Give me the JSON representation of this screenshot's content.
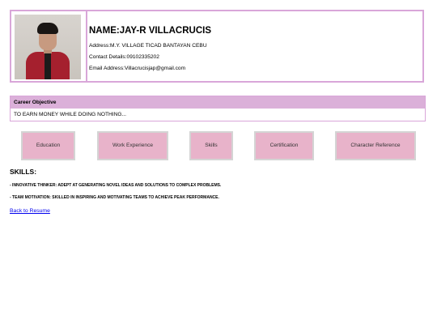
{
  "profile": {
    "name": "NAME:JAY-R VILLACRUCIS",
    "address": "Address:M.Y. VILLAGE TICAD BANTAYAN CEBU",
    "contact": "Contact Details:09102335202",
    "email": "Email Address:Villacrucisjap@gmail.com"
  },
  "career": {
    "heading": "Career Objective",
    "text": "TO EARN MONEY WHILE DOING NOTHING..."
  },
  "nav": {
    "education": "Education",
    "work_experience": "Work Experience",
    "skills": "Skills",
    "certification": "Certification",
    "character_reference": "Character Reference"
  },
  "skills": {
    "title": "SKILLS:",
    "items": [
      "- INNOVATIVE THINKER: ADEPT AT GENERATING NOVEL IDEAS AND SOLUTIONS TO COMPLEX PROBLEMS.",
      "- TEAM MOTIVATION: SKILLED IN INSPIRING AND MOTIVATING TEAMS TO ACHIEVE PEAK PERFORMANCE."
    ]
  },
  "back_link": "Back to Resume",
  "colors": {
    "border": "#d9a6d9",
    "header_fill": "#dbb0d9",
    "button_fill": "#e8b3ca",
    "link": "#0000ee"
  }
}
